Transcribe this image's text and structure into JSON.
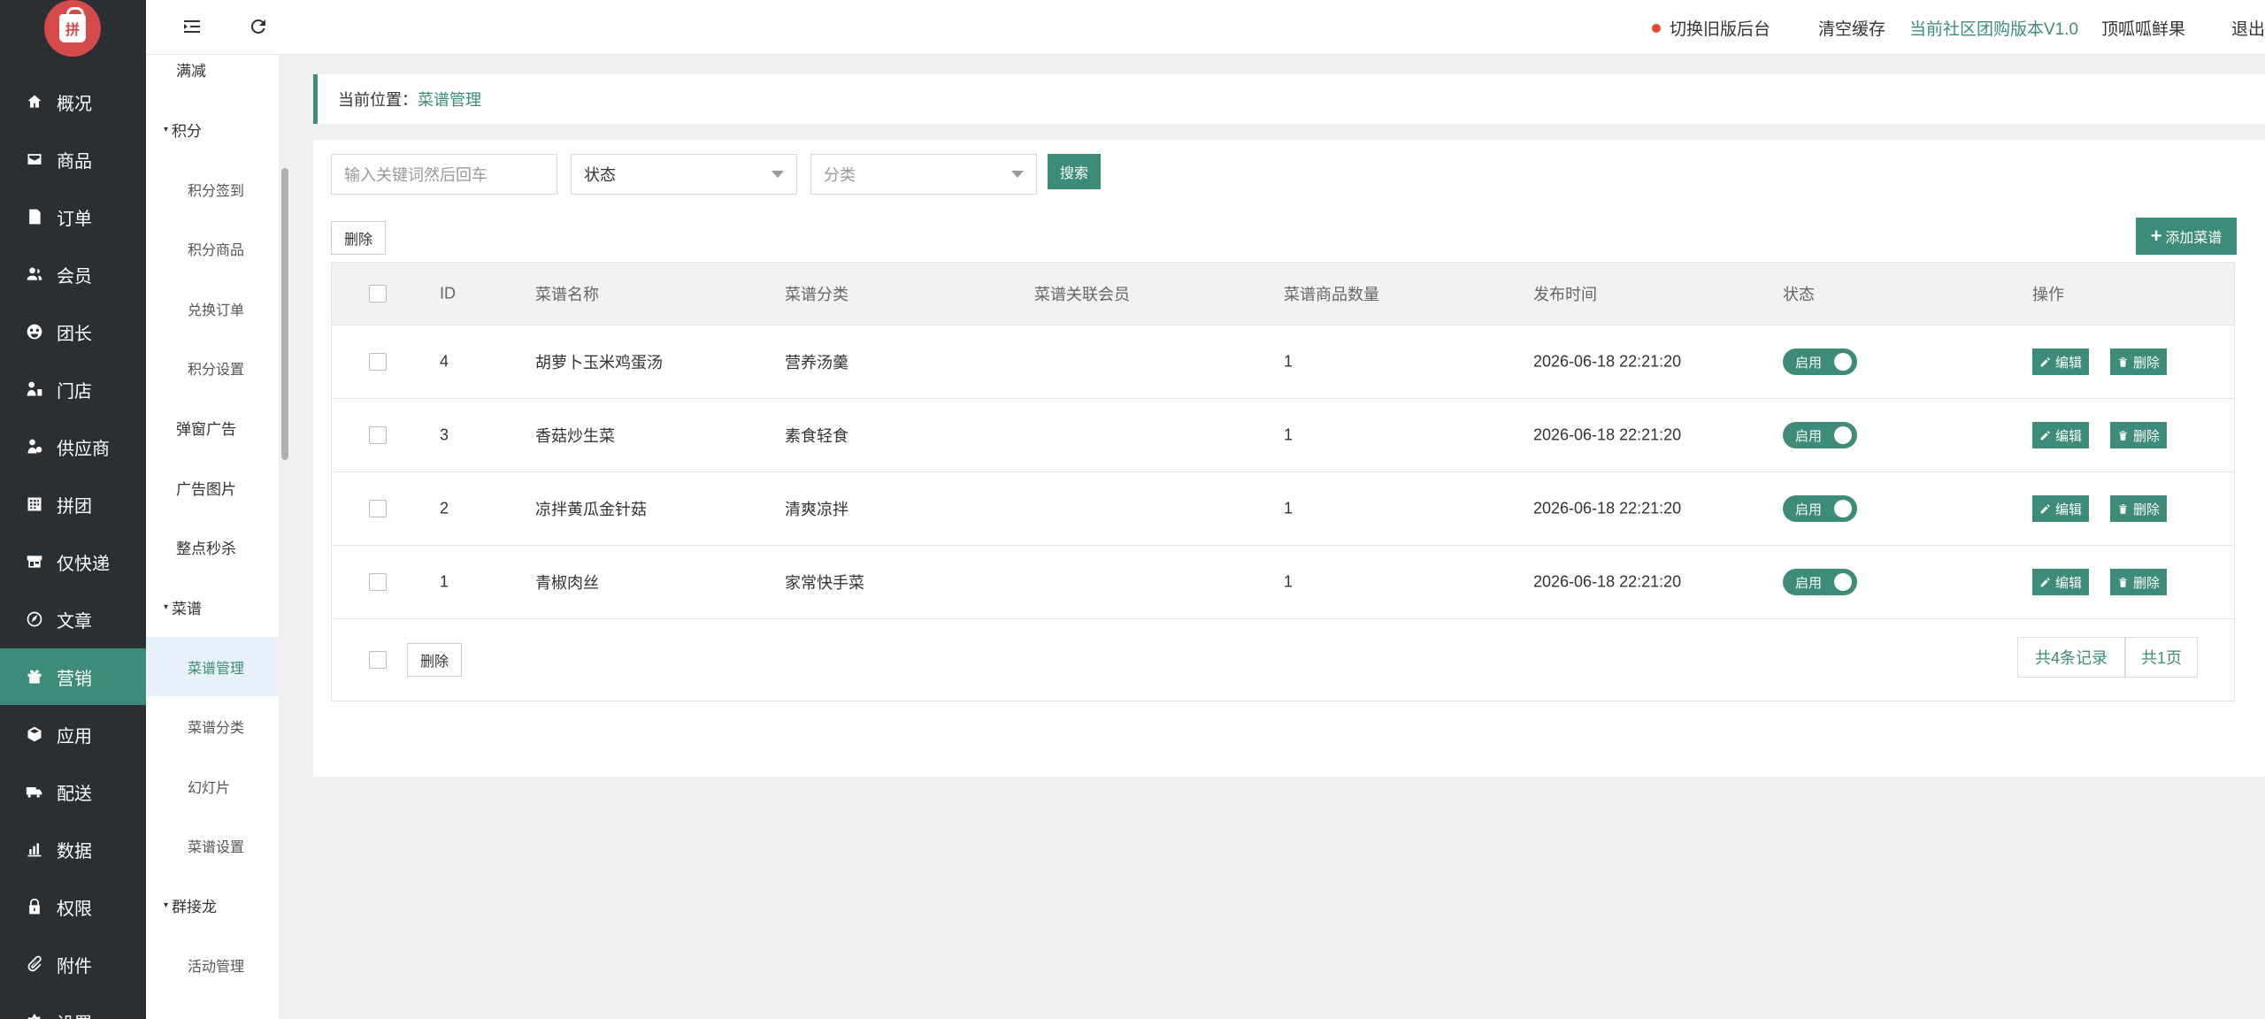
{
  "logo": {
    "glyph": "拼"
  },
  "nav": [
    {
      "label": "概况",
      "icon": "home-icon"
    },
    {
      "label": "商品",
      "icon": "goods-icon"
    },
    {
      "label": "订单",
      "icon": "order-icon"
    },
    {
      "label": "会员",
      "icon": "member-icon"
    },
    {
      "label": "团长",
      "icon": "leader-icon"
    },
    {
      "label": "门店",
      "icon": "store-icon"
    },
    {
      "label": "供应商",
      "icon": "supplier-icon"
    },
    {
      "label": "拼团",
      "icon": "group-buy-icon"
    },
    {
      "label": "仅快递",
      "icon": "express-icon"
    },
    {
      "label": "文章",
      "icon": "article-icon"
    },
    {
      "label": "营销",
      "icon": "gift-icon",
      "active": true
    },
    {
      "label": "应用",
      "icon": "app-icon"
    },
    {
      "label": "配送",
      "icon": "truck-icon"
    },
    {
      "label": "数据",
      "icon": "chart-icon"
    },
    {
      "label": "权限",
      "icon": "lock-icon"
    },
    {
      "label": "附件",
      "icon": "attachment-icon"
    },
    {
      "label": "设置",
      "icon": "settings-icon"
    }
  ],
  "submenu": [
    {
      "label": "满减",
      "level": 1
    },
    {
      "label": "积分",
      "level": 0
    },
    {
      "label": "积分签到",
      "level": 2
    },
    {
      "label": "积分商品",
      "level": 2
    },
    {
      "label": "兑换订单",
      "level": 2
    },
    {
      "label": "积分设置",
      "level": 2
    },
    {
      "label": "弹窗广告",
      "level": 1
    },
    {
      "label": "广告图片",
      "level": 1
    },
    {
      "label": "整点秒杀",
      "level": 1
    },
    {
      "label": "菜谱",
      "level": 0
    },
    {
      "label": "菜谱管理",
      "level": 2,
      "active": true
    },
    {
      "label": "菜谱分类",
      "level": 2
    },
    {
      "label": "幻灯片",
      "level": 2
    },
    {
      "label": "菜谱设置",
      "level": 2
    },
    {
      "label": "群接龙",
      "level": 0
    },
    {
      "label": "活动管理",
      "level": 2
    }
  ],
  "header": {
    "switch_old": "切换旧版后台",
    "clear_cache": "清空缓存",
    "version": "当前社区团购版本V1.0",
    "shop_name": "顶呱呱鲜果",
    "logout": "退出"
  },
  "breadcrumb": {
    "prefix": "当前位置：",
    "current": "菜谱管理"
  },
  "filters": {
    "keyword_placeholder": "输入关键词然后回车",
    "status_label": "状态",
    "category_placeholder": "分类",
    "search_label": "搜索"
  },
  "toolbar": {
    "delete_label": "删除",
    "add_label": "添加菜谱"
  },
  "table": {
    "columns": [
      "ID",
      "菜谱名称",
      "菜谱分类",
      "菜谱关联会员",
      "菜谱商品数量",
      "发布时间",
      "状态",
      "操作"
    ],
    "rows": [
      {
        "id": "4",
        "name": "胡萝卜玉米鸡蛋汤",
        "category": "营养汤羹",
        "member": "",
        "count": "1",
        "time": "2026-06-18 22:21:20",
        "status": "启用"
      },
      {
        "id": "3",
        "name": "香菇炒生菜",
        "category": "素食轻食",
        "member": "",
        "count": "1",
        "time": "2026-06-18 22:21:20",
        "status": "启用"
      },
      {
        "id": "2",
        "name": "凉拌黄瓜金针菇",
        "category": "清爽凉拌",
        "member": "",
        "count": "1",
        "time": "2026-06-18 22:21:20",
        "status": "启用"
      },
      {
        "id": "1",
        "name": "青椒肉丝",
        "category": "家常快手菜",
        "member": "",
        "count": "1",
        "time": "2026-06-18 22:21:20",
        "status": "启用"
      }
    ],
    "edit_label": "编辑",
    "row_delete_label": "删除"
  },
  "footer": {
    "delete_label": "删除",
    "total_records": "共4条记录",
    "total_pages": "共1页"
  },
  "colors": {
    "accent": "#3d8b79",
    "sidebar": "#2a2f33",
    "logo": "#d64a4a",
    "dot": "#e84a28"
  }
}
